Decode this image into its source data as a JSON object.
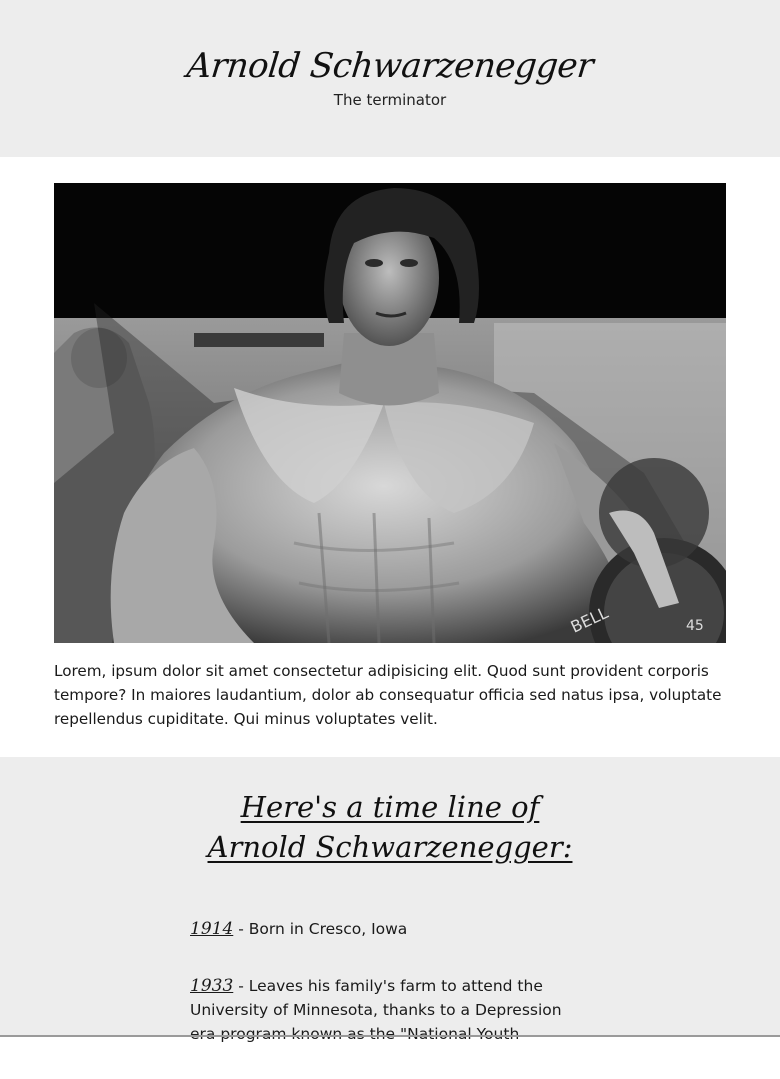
{
  "header": {
    "name": "Arnold Schwarzenegger",
    "subtitle": "The terminator"
  },
  "main": {
    "intro": "Lorem, ipsum dolor sit amet consectetur adipisicing elit. Quod sunt provident corporis tempore? In maiores laudantium, dolor ab consequatur officia sed natus ipsa, voluptate repellendus cupiditate. Qui minus voluptates velit."
  },
  "timeline": {
    "heading_line1": "Here's a time line of",
    "heading_line2": "Arnold Schwarzenegger:",
    "items": [
      {
        "year": "1914",
        "text": "- Born in Cresco, Iowa"
      },
      {
        "year": "1933",
        "text": "- Leaves his family's farm to attend the University of Minnesota, thanks to a Depression era program known as the \"National Youth"
      }
    ]
  }
}
